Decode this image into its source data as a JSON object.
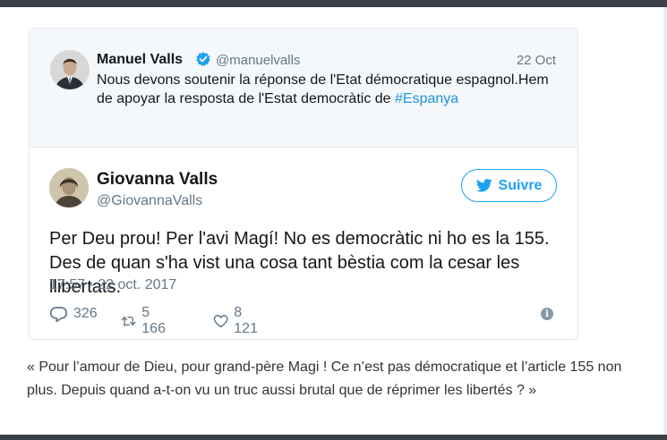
{
  "quoted_tweet": {
    "author_name": "Manuel Valls",
    "handle": "@manuelvalls",
    "date": "22 Oct",
    "text": "Nous devons soutenir la réponse de l'Etat démocratique espagnol.Hem de apoyar la resposta de l'Estat democràtic de ",
    "hashtag": "#Espanya"
  },
  "tweet": {
    "author_name": "Giovanna Valls",
    "handle": "@GiovannaValls",
    "follow_label": "Suivre",
    "text": "Per Deu prou! Per l'avi Magí! No es democràtic ni ho es la 155. Des de quan s'ha vist una cosa tant bèstia com la cesar les llibertats.",
    "timestamp": "17:57 - 22 oct. 2017",
    "replies": "326",
    "retweets": "5 166",
    "likes": "8 121"
  },
  "caption": "« Pour l’amour de Dieu, pour grand-père Magi ! Ce n’est pas démocratique et l’article 155 non plus. Depuis quand a-t-on vu un truc aussi brutal que de réprimer les libertés ? »",
  "colors": {
    "twitter_blue": "#1da1f2",
    "link_blue": "#1b95e0",
    "secondary_text": "#657786"
  },
  "icons": [
    "verified-badge-icon",
    "twitter-bird-icon",
    "reply-icon",
    "retweet-icon",
    "like-icon",
    "info-icon"
  ]
}
